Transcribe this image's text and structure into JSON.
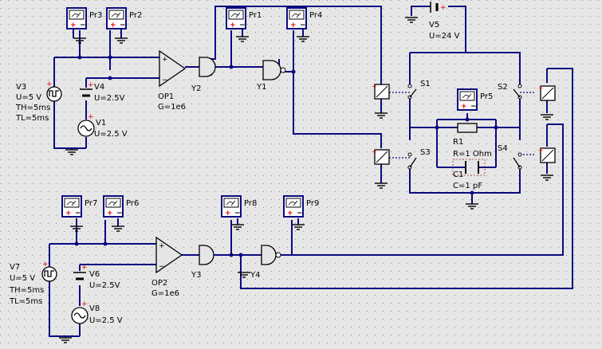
{
  "colors": {
    "background": "#e6e6e6",
    "wire": "#0a0a80",
    "symbol": "#000000",
    "polarity": "#e00000"
  },
  "probes": [
    "Pr1",
    "Pr2",
    "Pr3",
    "Pr4",
    "Pr5",
    "Pr6",
    "Pr7",
    "Pr8",
    "Pr9"
  ],
  "sources": {
    "V1": {
      "name": "V1",
      "value": "U=2.5 V"
    },
    "V3": {
      "name": "V3",
      "value": "U=5 V",
      "th": "TH=5ms",
      "tl": "TL=5ms"
    },
    "V4": {
      "name": "V4",
      "value": "U=2.5V"
    },
    "V5": {
      "name": "V5",
      "value": "U=24 V"
    },
    "V6": {
      "name": "V6",
      "value": "U=2.5V"
    },
    "V7": {
      "name": "V7",
      "value": "U=5 V",
      "th": "TH=5ms",
      "tl": "TL=5ms"
    },
    "V8": {
      "name": "V8",
      "value": "U=2.5 V"
    }
  },
  "opamps": {
    "OP1": {
      "name": "OP1",
      "gain": "G=1e6"
    },
    "OP2": {
      "name": "OP2",
      "gain": "G=1e6"
    }
  },
  "gates": [
    "Y1",
    "Y2",
    "Y3",
    "Y4"
  ],
  "switches": [
    "S1",
    "S2",
    "S3",
    "S4"
  ],
  "r1": {
    "name": "R1",
    "value": "R=1 Ohm"
  },
  "c1": {
    "name": "C1",
    "value": "C=1 pF"
  }
}
